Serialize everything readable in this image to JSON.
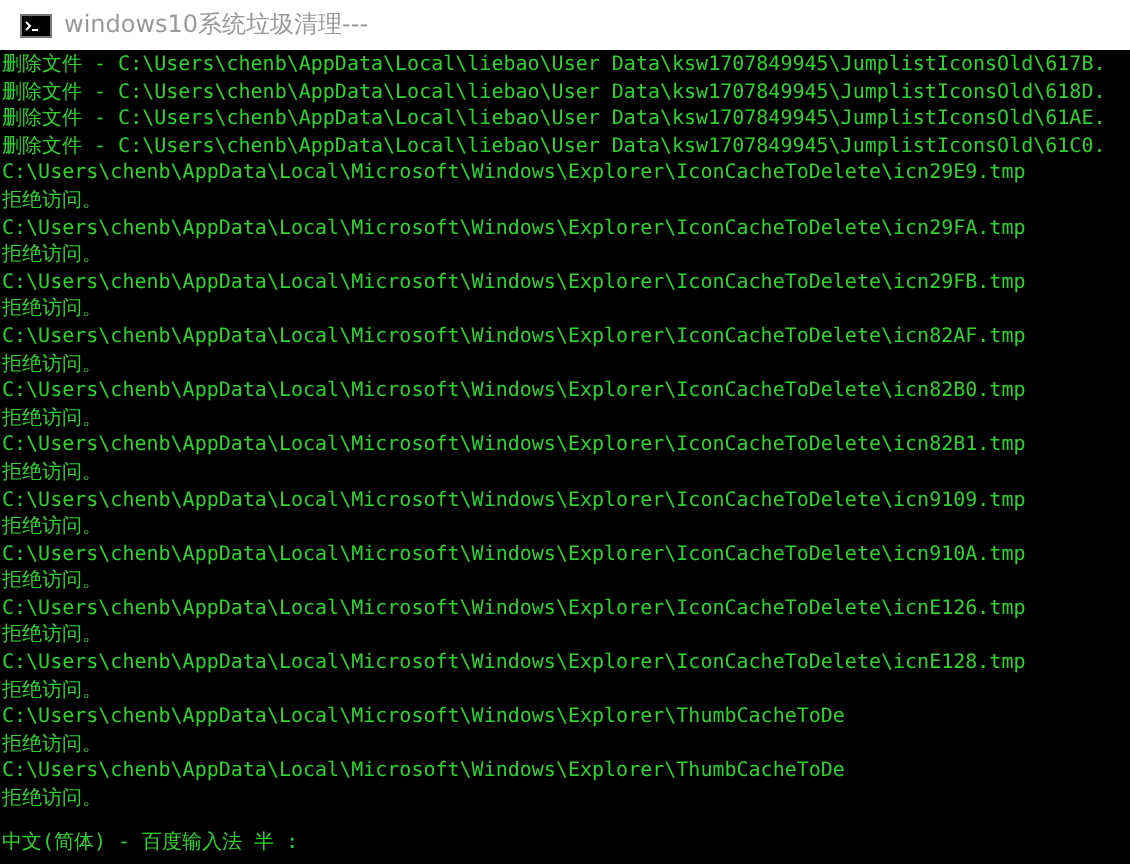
{
  "window": {
    "title": "windows10系统垃圾清理---"
  },
  "console_lines": [
    "删除文件 - C:\\Users\\chenb\\AppData\\Local\\liebao\\User Data\\ksw1707849945\\JumplistIconsOld\\617B.",
    "删除文件 - C:\\Users\\chenb\\AppData\\Local\\liebao\\User Data\\ksw1707849945\\JumplistIconsOld\\618D.",
    "删除文件 - C:\\Users\\chenb\\AppData\\Local\\liebao\\User Data\\ksw1707849945\\JumplistIconsOld\\61AE.",
    "删除文件 - C:\\Users\\chenb\\AppData\\Local\\liebao\\User Data\\ksw1707849945\\JumplistIconsOld\\61C0.",
    "C:\\Users\\chenb\\AppData\\Local\\Microsoft\\Windows\\Explorer\\IconCacheToDelete\\icn29E9.tmp",
    "拒绝访问。",
    "C:\\Users\\chenb\\AppData\\Local\\Microsoft\\Windows\\Explorer\\IconCacheToDelete\\icn29FA.tmp",
    "拒绝访问。",
    "C:\\Users\\chenb\\AppData\\Local\\Microsoft\\Windows\\Explorer\\IconCacheToDelete\\icn29FB.tmp",
    "拒绝访问。",
    "C:\\Users\\chenb\\AppData\\Local\\Microsoft\\Windows\\Explorer\\IconCacheToDelete\\icn82AF.tmp",
    "拒绝访问。",
    "C:\\Users\\chenb\\AppData\\Local\\Microsoft\\Windows\\Explorer\\IconCacheToDelete\\icn82B0.tmp",
    "拒绝访问。",
    "C:\\Users\\chenb\\AppData\\Local\\Microsoft\\Windows\\Explorer\\IconCacheToDelete\\icn82B1.tmp",
    "拒绝访问。",
    "C:\\Users\\chenb\\AppData\\Local\\Microsoft\\Windows\\Explorer\\IconCacheToDelete\\icn9109.tmp",
    "拒绝访问。",
    "C:\\Users\\chenb\\AppData\\Local\\Microsoft\\Windows\\Explorer\\IconCacheToDelete\\icn910A.tmp",
    "拒绝访问。",
    "C:\\Users\\chenb\\AppData\\Local\\Microsoft\\Windows\\Explorer\\IconCacheToDelete\\icnE126.tmp",
    "拒绝访问。",
    "C:\\Users\\chenb\\AppData\\Local\\Microsoft\\Windows\\Explorer\\IconCacheToDelete\\icnE128.tmp",
    "拒绝访问。",
    "C:\\Users\\chenb\\AppData\\Local\\Microsoft\\Windows\\Explorer\\ThumbCacheToDe",
    "拒绝访问。",
    "C:\\Users\\chenb\\AppData\\Local\\Microsoft\\Windows\\Explorer\\ThumbCacheToDe",
    "拒绝访问。"
  ],
  "ime_status": "中文(简体) - 百度输入法 半 :"
}
